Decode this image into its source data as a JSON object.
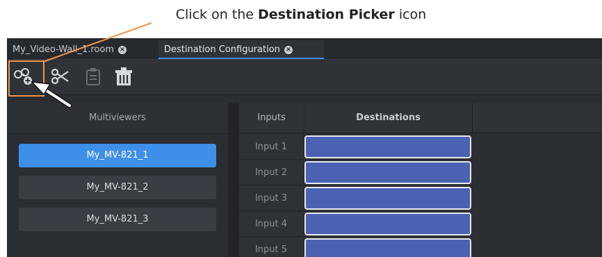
{
  "caption": {
    "prefix": "Click on the ",
    "bold": "Destination Picker",
    "suffix": " icon"
  },
  "tabs": [
    {
      "label": "My_Video-Wall_1.room",
      "active": false
    },
    {
      "label": "Destination Configuration",
      "active": true
    }
  ],
  "toolbar": {
    "buttons": [
      {
        "name": "destination-picker-icon"
      },
      {
        "name": "scissors-icon"
      },
      {
        "name": "clipboard-icon"
      },
      {
        "name": "trash-icon"
      }
    ]
  },
  "multiviewers": {
    "header": "Multiviewers",
    "items": [
      "My_MV-821_1",
      "My_MV-821_2",
      "My_MV-821_3"
    ],
    "selected_index": 0
  },
  "grid": {
    "inputs_header": "Inputs",
    "destinations_header": "Destinations",
    "inputs": [
      "Input 1",
      "Input 2",
      "Input 3",
      "Input 4",
      "Input 5"
    ]
  },
  "colors": {
    "highlight": "#f0964a",
    "selected": "#3d8fe8",
    "destination_cell": "#4b62b3"
  }
}
